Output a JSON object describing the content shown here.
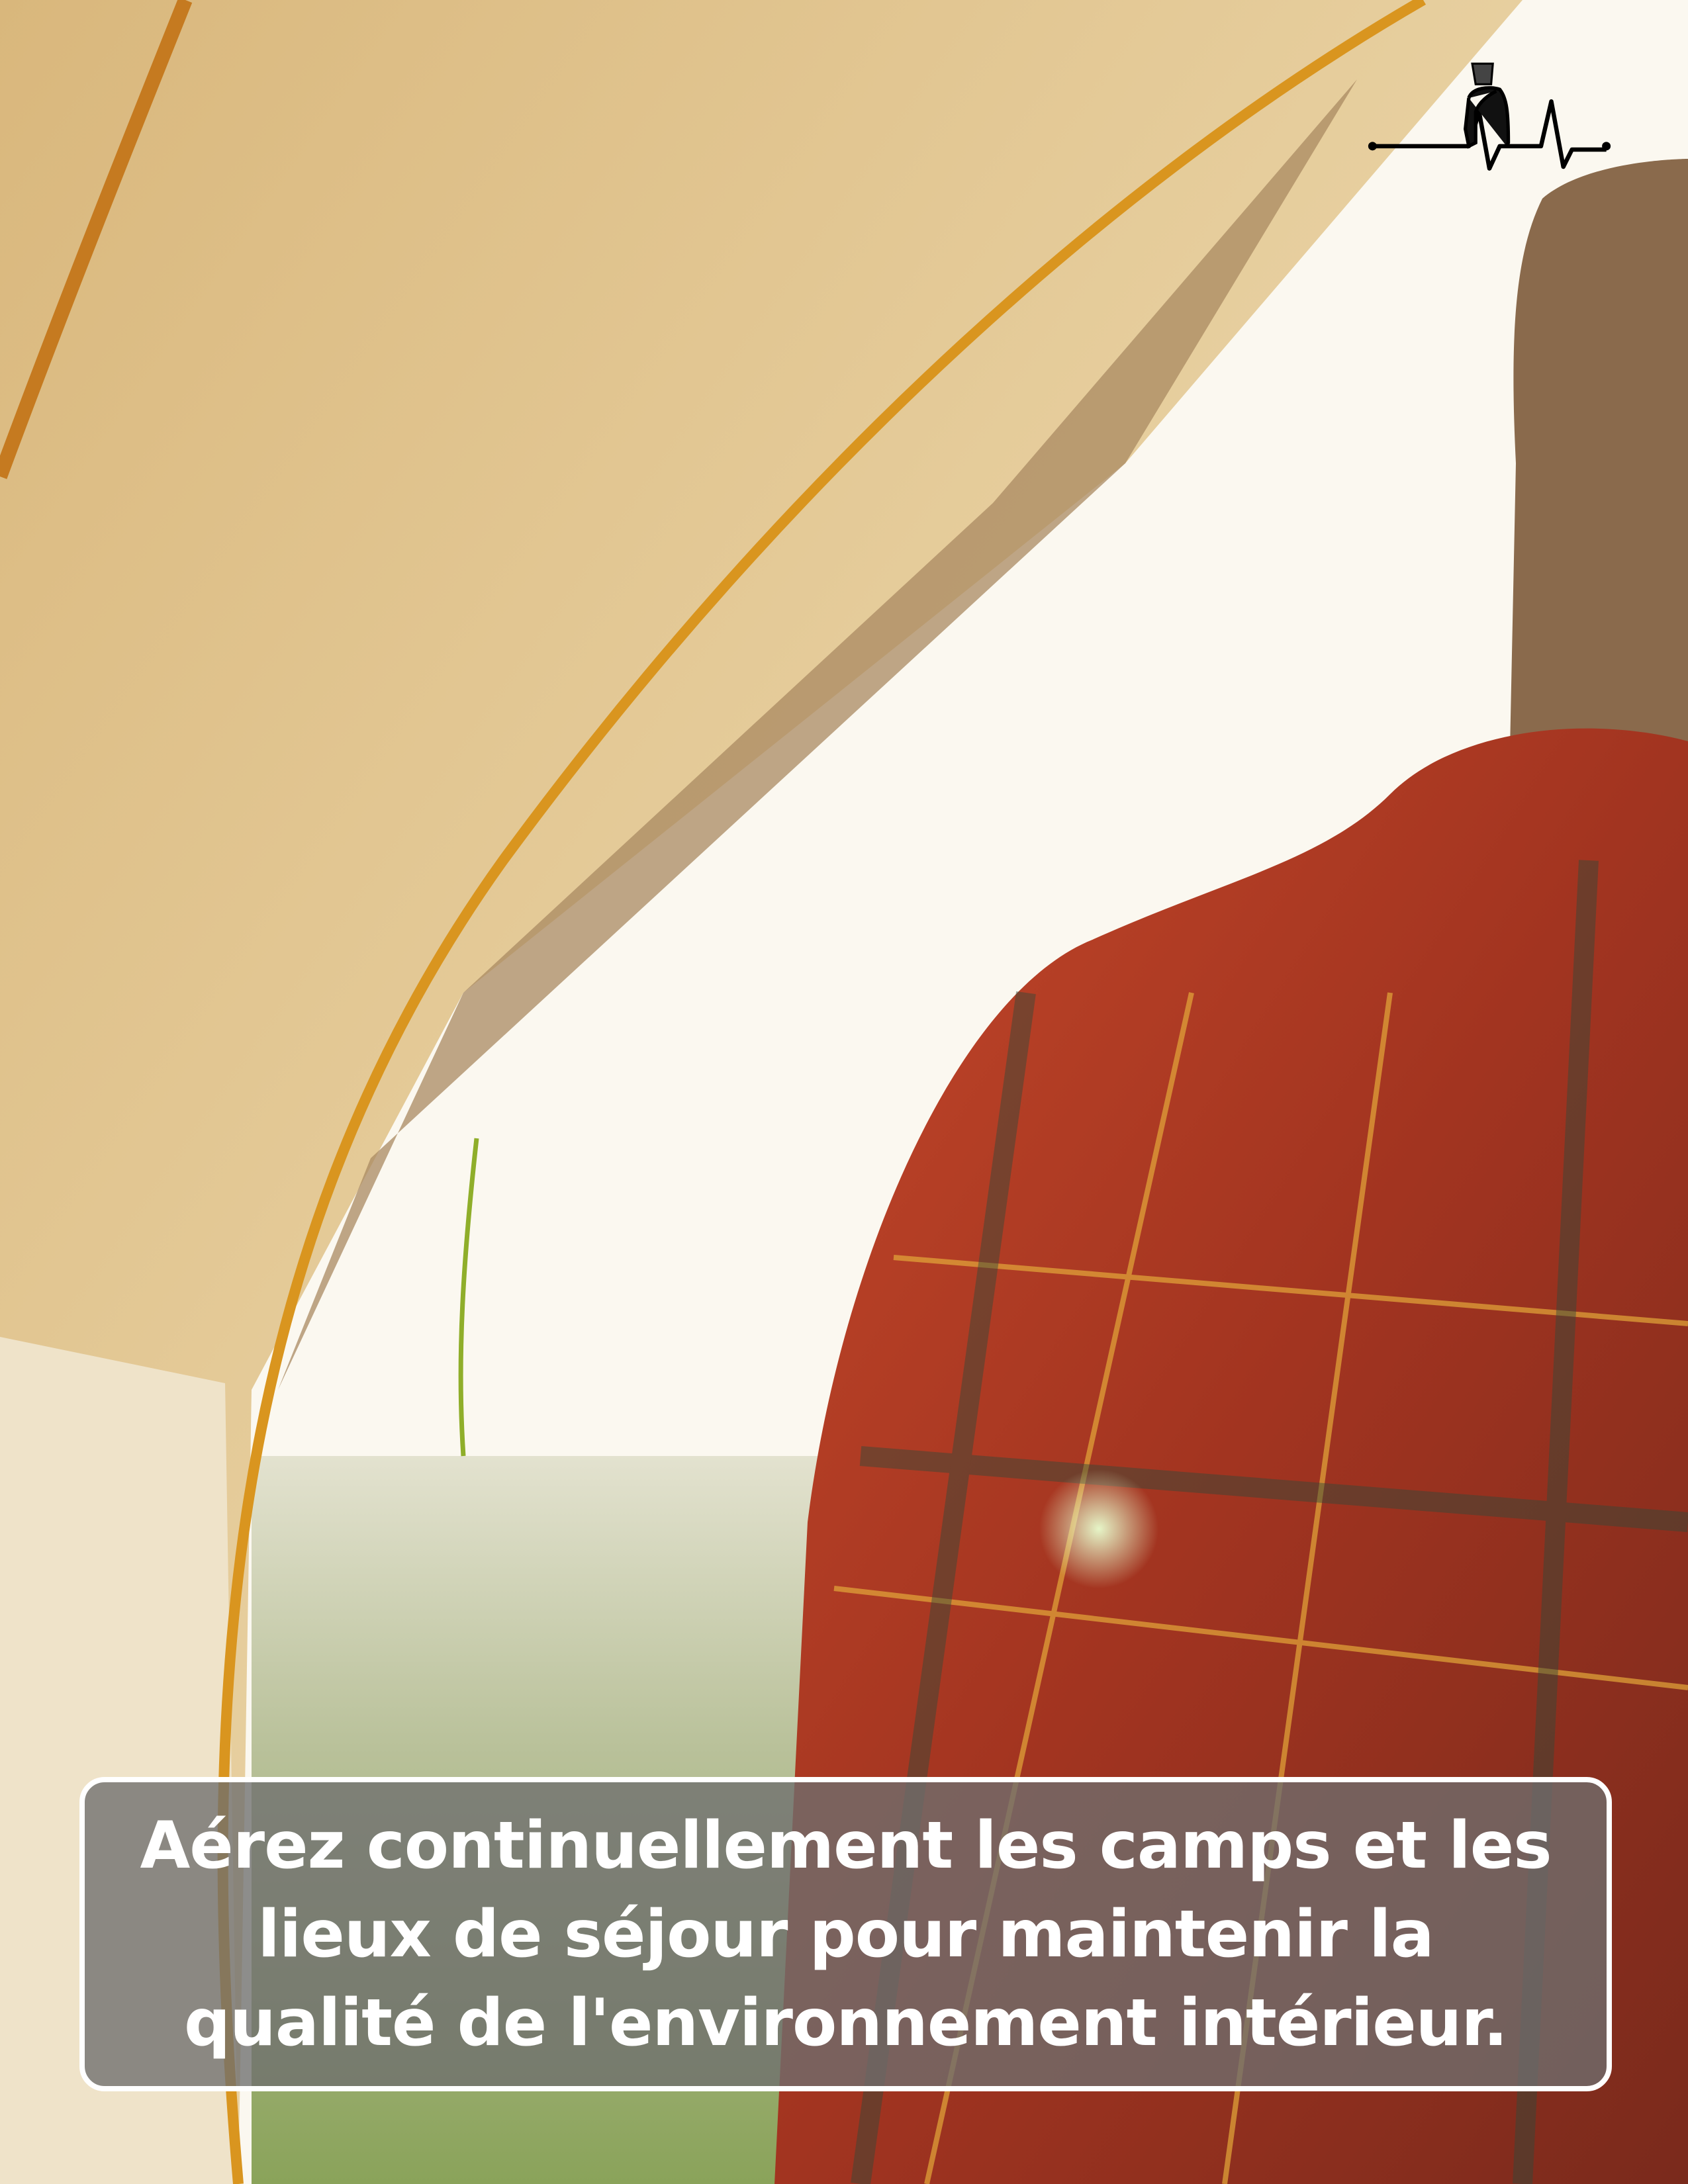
{
  "caption": {
    "text": "Aérez continuellement les camps et les lieux de séjour pour maintenir la qualité de l'environnement intérieur."
  },
  "logo": {
    "icon": "person-heartbeat-logo"
  },
  "colors": {
    "tent": "#e6c890",
    "sky": "#fbf8f0",
    "shirt": "#b8391f",
    "caption_bg": "#6e6e6e",
    "caption_text": "#ffffff"
  }
}
